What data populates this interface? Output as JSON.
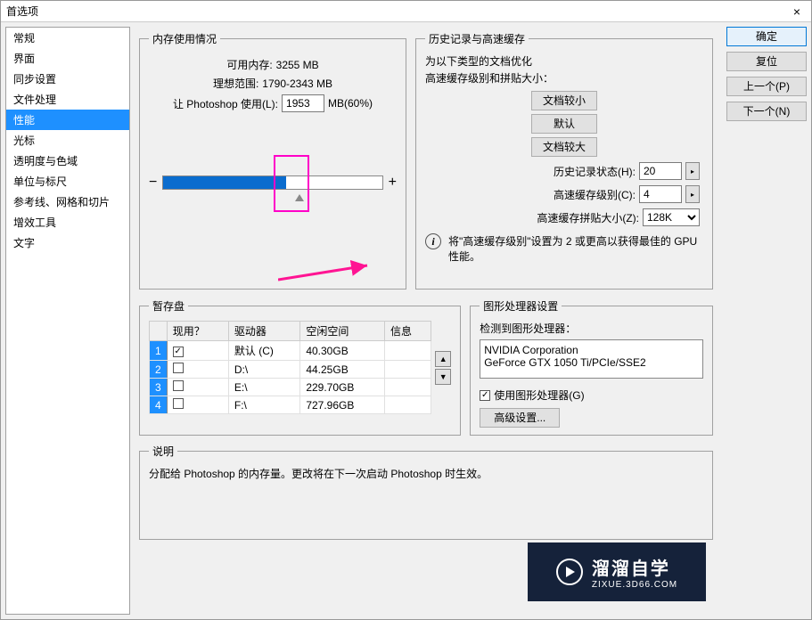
{
  "window": {
    "title": "首选项",
    "close": "×"
  },
  "sidebar": {
    "items": [
      "常规",
      "界面",
      "同步设置",
      "文件处理",
      "性能",
      "光标",
      "透明度与色域",
      "单位与标尺",
      "参考线、网格和切片",
      "增效工具",
      "文字"
    ],
    "selectedIndex": 4
  },
  "buttons": {
    "ok": "确定",
    "reset": "复位",
    "prev": "上一个(P)",
    "next": "下一个(N)"
  },
  "memory": {
    "legend": "内存使用情况",
    "availLabel": "可用内存:",
    "availValue": "3255 MB",
    "idealLabel": "理想范围:",
    "idealValue": "1790-2343 MB",
    "useLabel": "让 Photoshop 使用(L):",
    "useValue": "1953",
    "useSuffix": "MB(60%)",
    "minus": "−",
    "plus": "+",
    "sliderFillPct": 60
  },
  "history": {
    "legend": "历史记录与高速缓存",
    "optTitle": "为以下类型的文档优化",
    "optSub": "高速缓存级别和拼贴大小：",
    "btnSmall": "文档较小",
    "btnDefault": "默认",
    "btnLarge": "文档较大",
    "statesLabel": "历史记录状态(H):",
    "statesValue": "20",
    "cacheLabel": "高速缓存级别(C):",
    "cacheValue": "4",
    "tileLabel": "高速缓存拼贴大小(Z):",
    "tileValue": "128K",
    "infoText": "将\"高速缓存级别\"设置为 2 或更高以获得最佳的 GPU 性能。"
  },
  "scratch": {
    "legend": "暂存盘",
    "cols": {
      "active": "现用？",
      "drive": "驱动器",
      "free": "空闲空间",
      "info": "信息"
    },
    "rows": [
      {
        "n": "1",
        "active": true,
        "drive": "默认 (C)",
        "free": "40.30GB",
        "info": ""
      },
      {
        "n": "2",
        "active": false,
        "drive": "D:\\",
        "free": "44.25GB",
        "info": ""
      },
      {
        "n": "3",
        "active": false,
        "drive": "E:\\",
        "free": "229.70GB",
        "info": ""
      },
      {
        "n": "4",
        "active": false,
        "drive": "F:\\",
        "free": "727.96GB",
        "info": ""
      }
    ]
  },
  "gpu": {
    "legend": "图形处理器设置",
    "detected": "检测到图形处理器：",
    "vendor": "NVIDIA Corporation",
    "model": "GeForce GTX 1050 Ti/PCIe/SSE2",
    "useGpu": "使用图形处理器(G)",
    "advanced": "高级设置..."
  },
  "desc": {
    "legend": "说明",
    "text": "分配给 Photoshop 的内存量。更改将在下一次启动 Photoshop 时生效。"
  },
  "watermark": {
    "big": "溜溜自学",
    "small": "ZIXUE.3D66.COM"
  }
}
